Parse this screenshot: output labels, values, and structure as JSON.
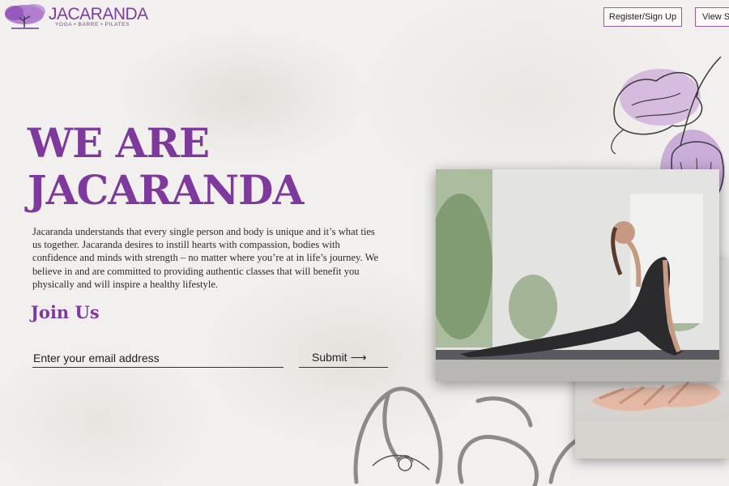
{
  "header": {
    "logo_word": "JACARANDA",
    "logo_tagline": "YOGA • BARRE • PILATES",
    "register_label": "Register/Sign Up",
    "view_label": "View Sc"
  },
  "hero": {
    "title_line1": "WE ARE",
    "title_line2": "JACARANDA",
    "body": "Jacaranda understands that every single person and body is unique and it’s what ties us together. Jacaranda desires to instill hearts with compassion, bodies with confidence and minds with strength – no matter where you’re at in life’s journey. We believe in and are committed to providing authentic classes that will benefit you physically and will inspire a healthy lifestyle."
  },
  "join": {
    "heading": "Join Us",
    "email_placeholder": "Enter your email address",
    "submit_label": "Submit ⟶"
  },
  "colors": {
    "brand_purple": "#7d3a9c",
    "background": "#f1efed"
  },
  "icons": [
    "jacaranda-tree-logo-icon",
    "flower-line-art-icon"
  ]
}
